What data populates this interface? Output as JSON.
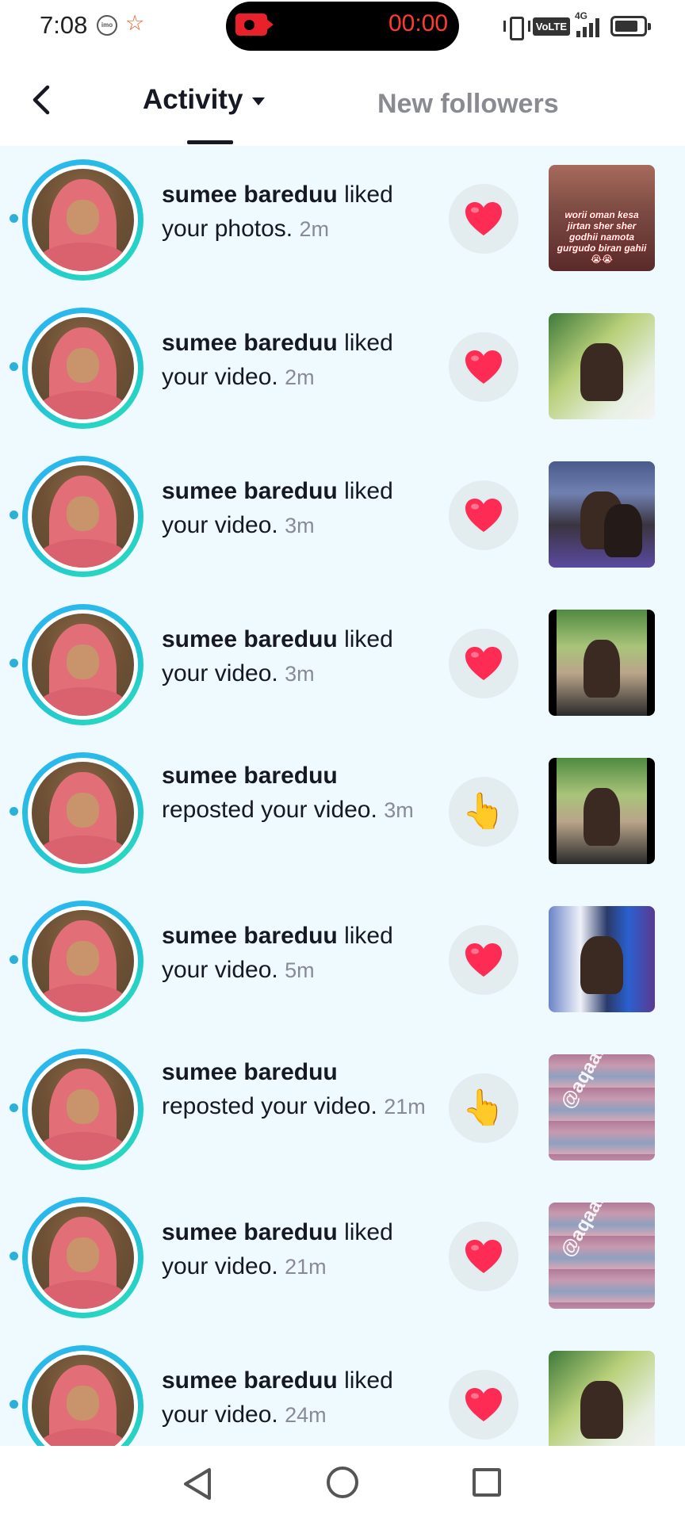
{
  "status_bar": {
    "time": "7:08",
    "imo_label": "imo",
    "recording_timer": "00:00",
    "network": "4G",
    "volte": "VoLTE",
    "icons": [
      "imo-icon",
      "star-icon",
      "screen-record-icon",
      "vibrate-icon",
      "volte-icon",
      "signal-icon",
      "battery-icon"
    ]
  },
  "header": {
    "tab_activity": "Activity",
    "tab_new_followers": "New followers"
  },
  "colors": {
    "list_bg": "#eefaff",
    "ring_start": "#2db4f5",
    "ring_end": "#28e0b5",
    "heart": "#fe2c55",
    "unread_dot": "#2bb1d8"
  },
  "notifications": [
    {
      "user": "sumee bareduu",
      "action": " liked your photos.",
      "time": "2m",
      "reaction": "heart",
      "thumb": "photo-text"
    },
    {
      "user": "sumee bareduu",
      "action": " liked your video.",
      "time": "2m",
      "reaction": "heart",
      "thumb": "selfie"
    },
    {
      "user": "sumee bareduu",
      "action": " liked your video.",
      "time": "3m",
      "reaction": "heart",
      "thumb": "duo"
    },
    {
      "user": "sumee bareduu",
      "action": " liked your video.",
      "time": "3m",
      "reaction": "heart",
      "thumb": "street"
    },
    {
      "user": "sumee bareduu",
      "action": " reposted your video.",
      "time": "3m",
      "reaction": "repost-hand",
      "thumb": "street"
    },
    {
      "user": "sumee bareduu",
      "action": " liked your video.",
      "time": "5m",
      "reaction": "heart",
      "thumb": "collage"
    },
    {
      "user": "sumee bareduu",
      "action": " reposted your video.",
      "time": "21m",
      "reaction": "repost-hand",
      "thumb": "watermark"
    },
    {
      "user": "sumee bareduu",
      "action": " liked your video.",
      "time": "21m",
      "reaction": "heart",
      "thumb": "watermark"
    },
    {
      "user": "sumee bareduu",
      "action": " liked your video.",
      "time": "24m",
      "reaction": "heart",
      "thumb": "selfie"
    }
  ],
  "thumb_texts": {
    "photo_caption": "worii oman kesa jirtan sher sher godhii namota gurgudo biran gahii😭😭",
    "watermark": "@aqaaliwwan"
  },
  "navbar": {
    "icons": [
      "nav-back-icon",
      "nav-home-icon",
      "nav-recents-icon"
    ]
  }
}
